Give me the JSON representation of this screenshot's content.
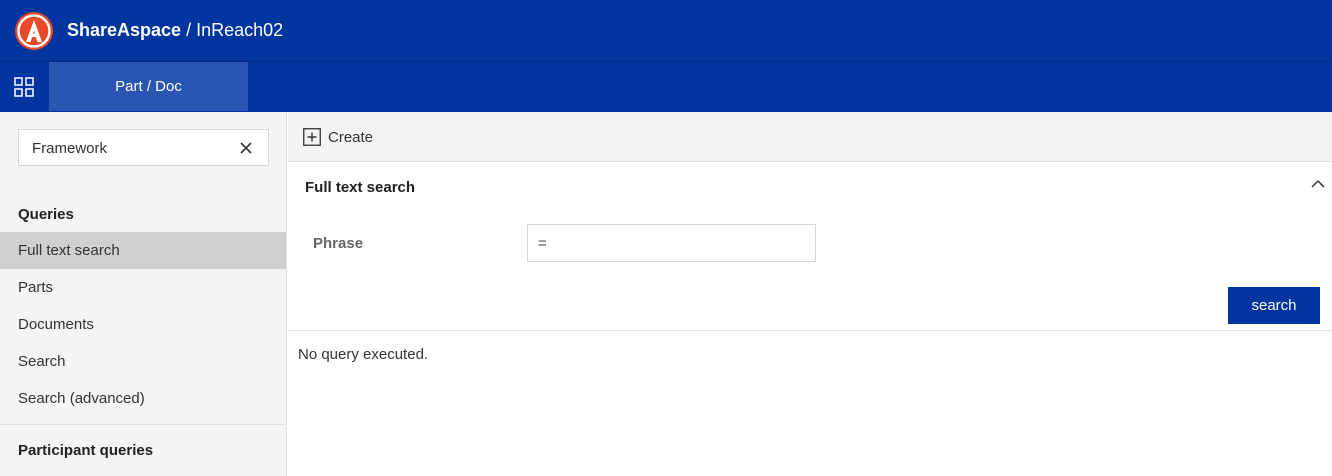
{
  "header": {
    "brand": "ShareAspace",
    "separator": " / ",
    "instance": "InReach02",
    "logo_color": "#e84a27"
  },
  "nav": {
    "grid_icon": "grid-icon",
    "tabs": [
      {
        "label": "Part / Doc",
        "active": true
      }
    ]
  },
  "sidebar": {
    "filter": {
      "value": "Framework",
      "clear_icon": "close-icon"
    },
    "sections": [
      {
        "title": "Queries",
        "items": [
          {
            "label": "Full text search",
            "active": true
          },
          {
            "label": "Parts"
          },
          {
            "label": "Documents"
          },
          {
            "label": "Search"
          },
          {
            "label": "Search (advanced)"
          }
        ]
      },
      {
        "title": "Participant queries",
        "items": []
      }
    ]
  },
  "toolbar": {
    "create_label": "Create",
    "create_icon": "plus-box-icon"
  },
  "panel": {
    "title": "Full text search",
    "collapse_icon": "chevron-up-icon",
    "fields": [
      {
        "label": "Phrase",
        "value": "="
      }
    ],
    "search_button": "search"
  },
  "results": {
    "status": "No query executed."
  },
  "colors": {
    "primary": "#0035a0",
    "tab_active": "#2a55b2",
    "sidebar_bg": "#f4f4f4",
    "selected_bg": "#d0d0d0"
  }
}
